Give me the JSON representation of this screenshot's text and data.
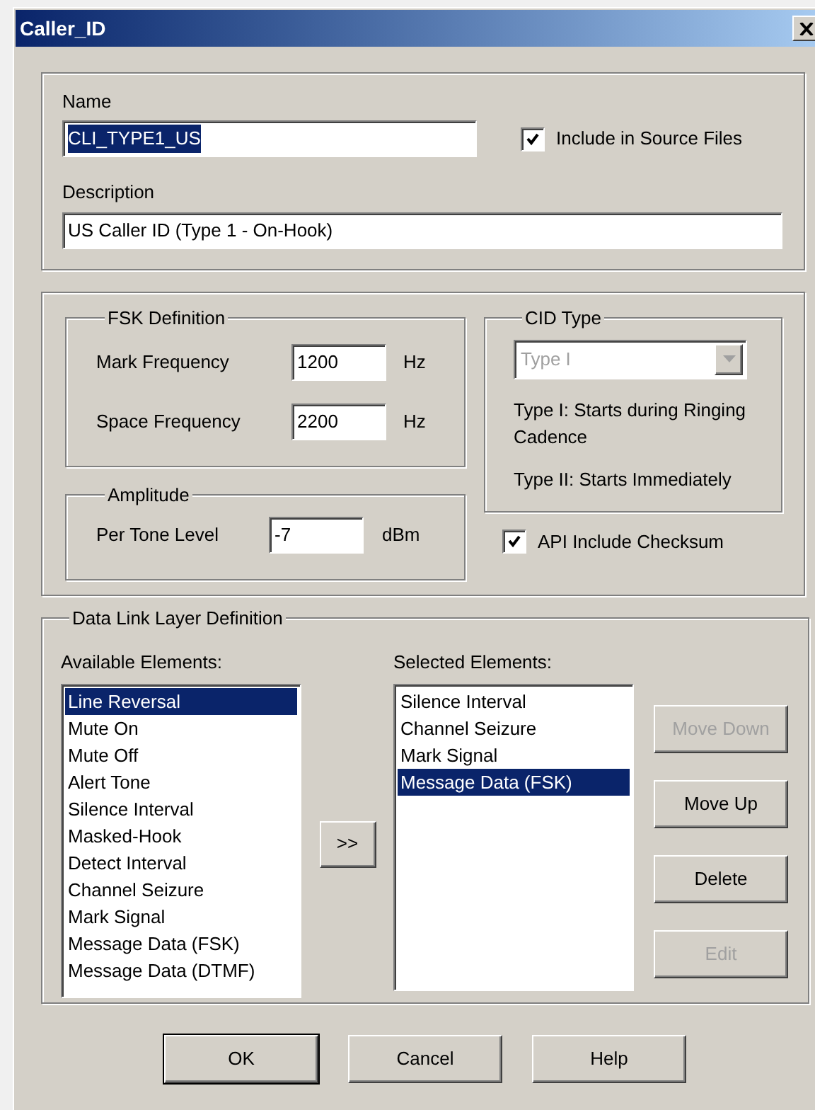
{
  "window": {
    "title": "Caller_ID"
  },
  "name": {
    "label": "Name",
    "value": "CLI_TYPE1_US",
    "text_selected": true
  },
  "include_source": {
    "label": "Include in Source Files",
    "checked": true
  },
  "description": {
    "label": "Description",
    "value": "US Caller ID (Type 1 - On-Hook)"
  },
  "fsk": {
    "title": "FSK Definition",
    "fields": [
      {
        "label": "Mark Frequency",
        "value": "1200",
        "unit": "Hz"
      },
      {
        "label": "Space Frequency",
        "value": "2200",
        "unit": "Hz"
      }
    ]
  },
  "amplitude": {
    "title": "Amplitude",
    "field": {
      "label": "Per Tone Level",
      "value": "-7",
      "unit": "dBm"
    }
  },
  "cid_type": {
    "title": "CID Type",
    "dropdown": {
      "value": "Type I",
      "disabled": true
    },
    "notes": [
      "Type I: Starts during Ringing Cadence",
      "Type II: Starts Immediately"
    ]
  },
  "api_checksum": {
    "label": "API Include Checksum",
    "checked": true
  },
  "data_link": {
    "title": "Data Link Layer Definition",
    "available": {
      "label": "Available Elements:",
      "items": [
        {
          "text": "Line Reversal",
          "selected": true
        },
        {
          "text": "Mute On",
          "selected": false
        },
        {
          "text": "Mute Off",
          "selected": false
        },
        {
          "text": "Alert Tone",
          "selected": false
        },
        {
          "text": "Silence Interval",
          "selected": false
        },
        {
          "text": "Masked-Hook",
          "selected": false
        },
        {
          "text": "Detect Interval",
          "selected": false
        },
        {
          "text": "Channel Seizure",
          "selected": false
        },
        {
          "text": "Mark Signal",
          "selected": false
        },
        {
          "text": "Message Data (FSK)",
          "selected": false
        },
        {
          "text": "Message Data (DTMF)",
          "selected": false
        }
      ]
    },
    "add_button": ">>",
    "chosen": {
      "label": "Selected Elements:",
      "items": [
        {
          "text": "Silence Interval",
          "selected": false
        },
        {
          "text": "Channel Seizure",
          "selected": false
        },
        {
          "text": "Mark Signal",
          "selected": false
        },
        {
          "text": "Message Data (FSK)",
          "selected": true
        }
      ]
    },
    "side_buttons": [
      {
        "label": "Move Down",
        "disabled": true
      },
      {
        "label": "Move Up",
        "disabled": false
      },
      {
        "label": "Delete",
        "disabled": false
      },
      {
        "label": "Edit",
        "disabled": true
      }
    ]
  },
  "buttons": [
    {
      "label": "OK",
      "default": true
    },
    {
      "label": "Cancel",
      "default": false
    },
    {
      "label": "Help",
      "default": false
    }
  ]
}
